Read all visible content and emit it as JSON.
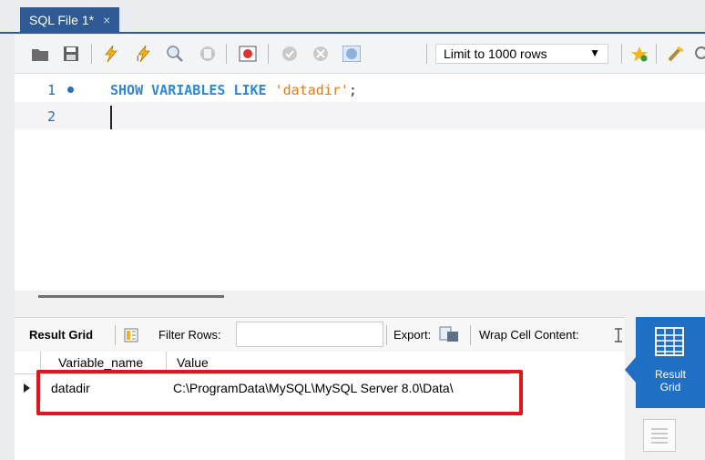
{
  "tab": {
    "title": "SQL File 1*",
    "close": "×"
  },
  "toolbar": {
    "limit_value": "Limit to 1000 rows",
    "icons": [
      "open-folder-icon",
      "save-icon",
      "execute-icon",
      "execute-current-icon",
      "explain-icon",
      "stop-icon",
      "toggle-error-icon",
      "commit-icon",
      "rollback-icon",
      "autocommit-icon",
      "limit-dropdown",
      "bookmark-icon",
      "beautify-icon"
    ]
  },
  "editor": {
    "lines": [
      {
        "num": "1",
        "kw": "SHOW VARIABLES LIKE",
        "str": "'datadir'",
        "end": ";"
      },
      {
        "num": "2"
      }
    ]
  },
  "results": {
    "result_grid_label": "Result Grid",
    "filter_rows_label": "Filter Rows:",
    "filter_value": "",
    "export_label": "Export:",
    "wrap_label": "Wrap Cell Content:",
    "columns": [
      "Variable_name",
      "Value"
    ],
    "rows": [
      {
        "variable_name": "datadir",
        "value": "C:\\ProgramData\\MySQL\\MySQL Server 8.0\\Data\\"
      }
    ]
  },
  "side": {
    "active_label_1": "Result",
    "active_label_2": "Grid"
  },
  "colors": {
    "accent": "#1f6fc5",
    "tab": "#2f5a93",
    "highlight": "#e0161e"
  }
}
